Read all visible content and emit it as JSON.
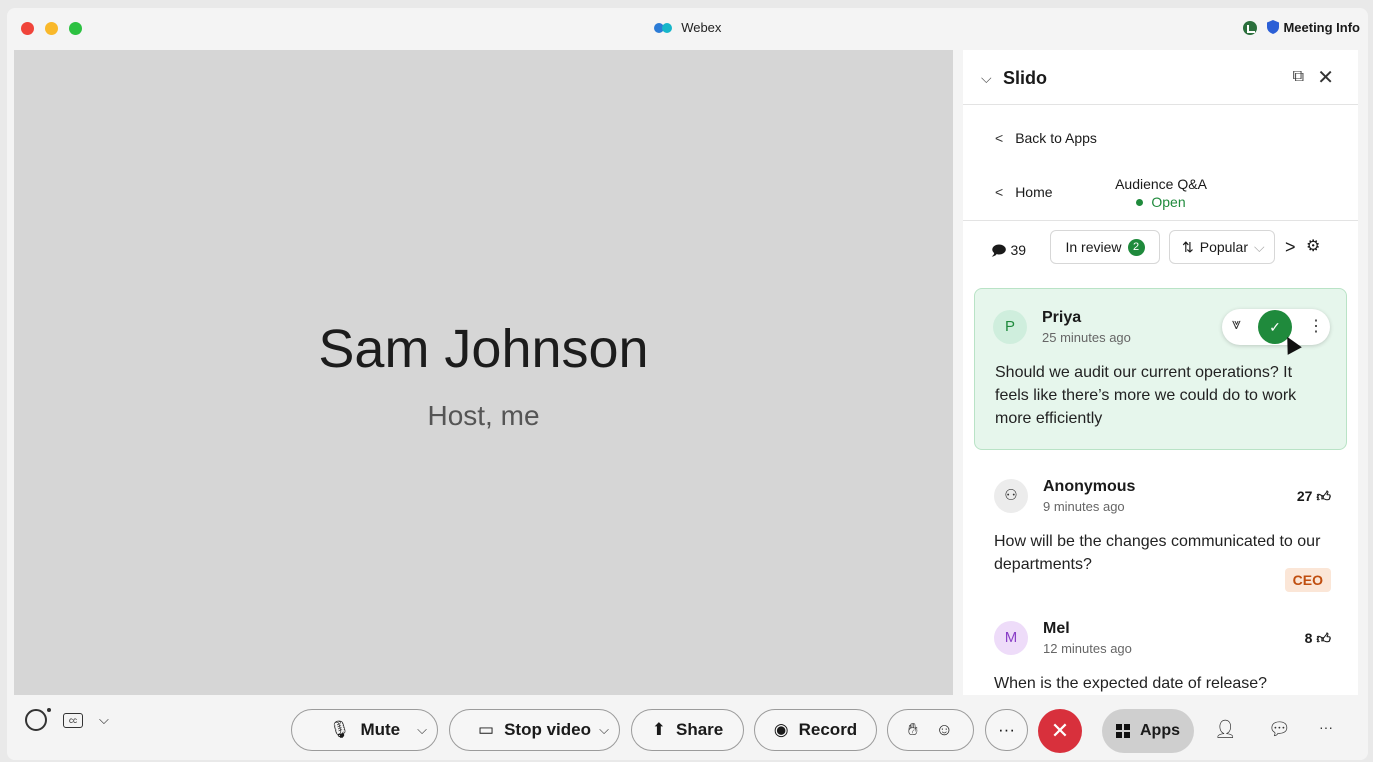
{
  "window": {
    "title": "Webex",
    "meeting_info_label": "Meeting Info"
  },
  "stage": {
    "participant_name": "Sam Johnson",
    "participant_role": "Host, me"
  },
  "panel": {
    "title": "Slido",
    "back_label": "Back to Apps",
    "home_label": "Home",
    "section_title": "Audience Q&A",
    "section_status": "Open",
    "comment_count": "39",
    "in_review_label": "In review",
    "in_review_count": "2",
    "sort_label": "Popular"
  },
  "questions": [
    {
      "avatar_initial": "P",
      "author": "Priya",
      "time": "25 minutes ago",
      "text": "Should we audit our current operations? It feels like there’s more we could do to work more efficiently"
    },
    {
      "avatar_initial": "",
      "author": "Anonymous",
      "time": "9 minutes ago",
      "likes": "27",
      "text": "How will be the changes communicated to our departments?",
      "tag": "CEO"
    },
    {
      "avatar_initial": "M",
      "author": "Mel",
      "time": "12 minutes ago",
      "likes": "8",
      "text": "When is the expected date of release?"
    }
  ],
  "controls": {
    "mute_label": "Mute",
    "video_label": "Stop video",
    "share_label": "Share",
    "record_label": "Record",
    "apps_label": "Apps"
  },
  "colors": {
    "accent_green": "#1f8a3c",
    "leave_red": "#d8303c",
    "highlight_bg": "#e6f6ec",
    "tag_bg": "#fbe6d7",
    "tag_text": "#c04e0f"
  }
}
